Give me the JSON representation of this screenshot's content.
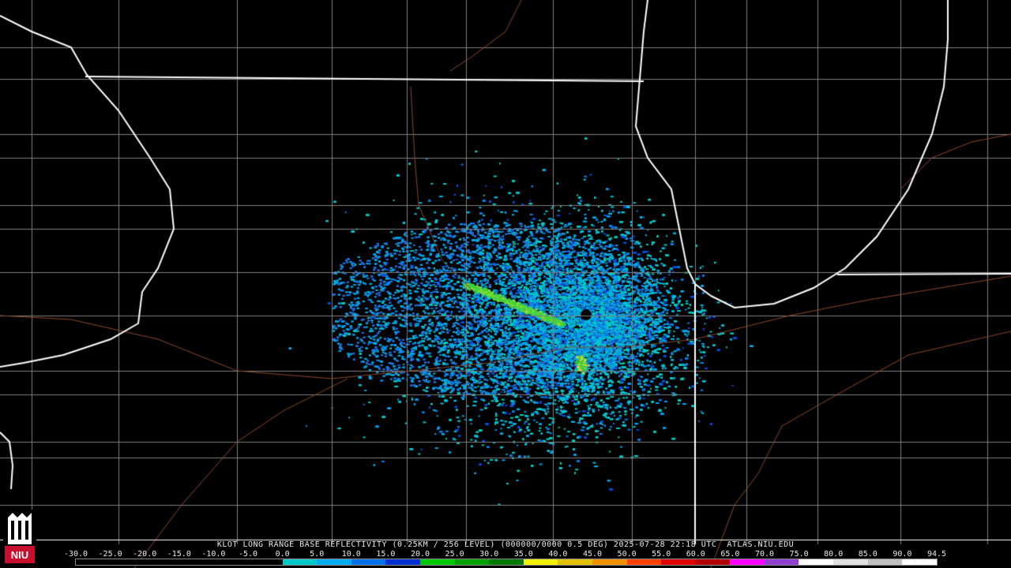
{
  "product": {
    "caption": "KLOT LONG RANGE BASE REFLECTIVITY (0.25KM / 256 LEVEL) (000000/0000 0.5 DEG) 2025-07-28 22:18 UTC  ATLAS.NIU.EDU"
  },
  "colorbar": {
    "ticks": [
      "-30.0",
      "-25.0",
      "-20.0",
      "-15.0",
      "-10.0",
      "-5.0",
      "0.0",
      "5.0",
      "10.0",
      "15.0",
      "20.0",
      "25.0",
      "30.0",
      "35.0",
      "40.0",
      "45.0",
      "50.0",
      "55.0",
      "60.0",
      "65.0",
      "70.0",
      "75.0",
      "80.0",
      "85.0",
      "90.0",
      "94.5"
    ],
    "colors": [
      "#000000",
      "#000000",
      "#000000",
      "#000000",
      "#000000",
      "#000000",
      "#00c8c8",
      "#00aaf0",
      "#0070e8",
      "#0030d0",
      "#00c800",
      "#00a000",
      "#007800",
      "#f0f000",
      "#e0c000",
      "#f09000",
      "#ff4000",
      "#e00000",
      "#b00000",
      "#ff00ff",
      "#9040d0",
      "#ffffff",
      "#e0e0e0",
      "#c0c0c0",
      "#ffffff"
    ]
  },
  "logo": {
    "text": "NIU"
  },
  "map": {
    "radar_site_label": "KLOT",
    "colors": {
      "state_border": "#ffffff",
      "county_border": "#808080",
      "river": "#8b4a2b",
      "background": "#000000"
    }
  }
}
